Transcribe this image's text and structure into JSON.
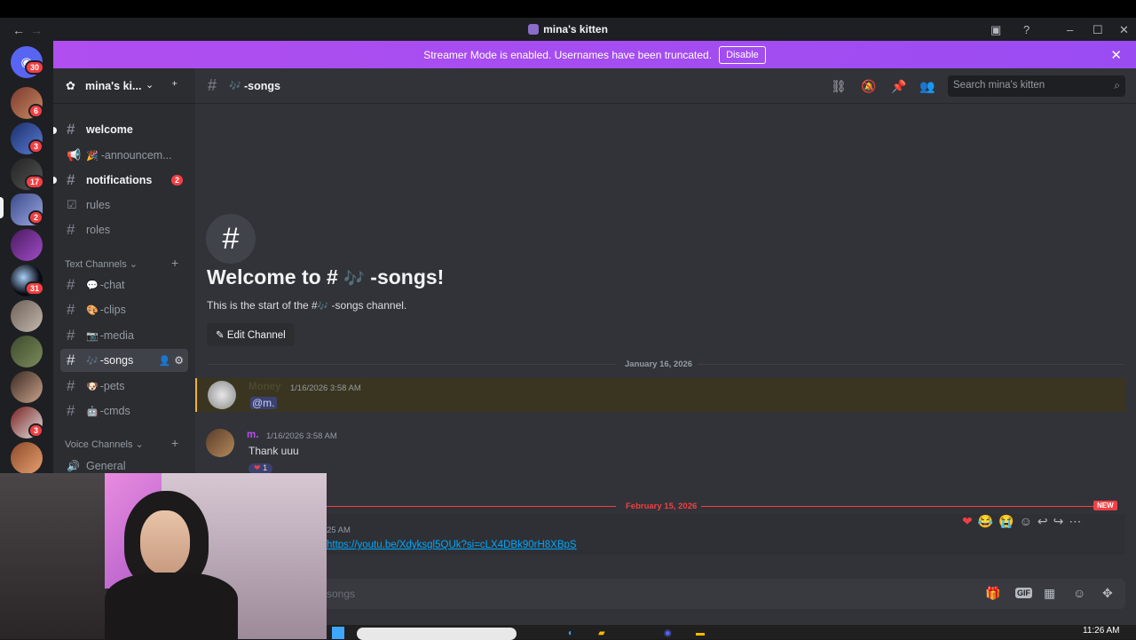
{
  "titlebar": {
    "title": "mina's kitten",
    "back": "←",
    "forward": "→",
    "minimize": "–",
    "maximize": "☐",
    "close": "✕"
  },
  "banner": {
    "text": "Streamer Mode is enabled. Usernames have been truncated.",
    "button": "Disable",
    "close": "✕"
  },
  "rail": {
    "home_badge": "30",
    "servers": [
      {
        "badge": "6"
      },
      {
        "badge": "3"
      },
      {
        "badge": "17"
      },
      {
        "badge": "2"
      },
      {
        "badge": ""
      },
      {
        "badge": "31"
      },
      {
        "badge": ""
      },
      {
        "badge": ""
      },
      {
        "badge": ""
      },
      {
        "badge": "3"
      },
      {
        "badge": ""
      }
    ]
  },
  "sidebar": {
    "guild_name": "mina's ki...",
    "channels_top": [
      {
        "name": "welcome",
        "style": "unread"
      },
      {
        "name": "-announcem...",
        "style": "muted"
      },
      {
        "name": "notifications",
        "style": "unread",
        "badge": "2"
      },
      {
        "name": "rules",
        "style": "normal"
      },
      {
        "name": "roles",
        "style": "normal"
      }
    ],
    "text_category": "Text Channels",
    "text_channels": [
      {
        "name": "-chat",
        "emoji": "💬"
      },
      {
        "name": "-clips",
        "emoji": "🎨"
      },
      {
        "name": "-media",
        "emoji": "📷"
      },
      {
        "name": "-songs",
        "emoji": "🎶"
      },
      {
        "name": "-pets",
        "emoji": "🐶"
      },
      {
        "name": "-cmds",
        "emoji": "🤖"
      }
    ],
    "voice_category": "Voice Channels",
    "voice_channels": [
      {
        "name": "General"
      }
    ]
  },
  "main": {
    "channel_name": "-songs",
    "search_placeholder": "Search mina's kitten",
    "welcome_hash": "#",
    "welcome_title_pre": "Welcome to #",
    "welcome_title_post": "-songs!",
    "welcome_sub_pre": "This is the start of the #",
    "welcome_sub_post": "-songs channel.",
    "edit_channel": "Edit Channel",
    "date_divider_1": "January 16, 2026",
    "date_divider_2": "February 15, 2026",
    "new_label": "NEW",
    "messages": [
      {
        "author": "Money",
        "time": "1/16/2026 3:58 AM",
        "content": "@m.",
        "highlight": true
      },
      {
        "author": "m.",
        "time": "1/16/2026 3:58 AM",
        "content": "Thank uuu",
        "reaction_count": "1"
      },
      {
        "time": "25 AM",
        "link": "https://youtu.be/Xdyksgl5QUk?si=cLX4DBk90rH8XBpS"
      }
    ],
    "composer_placeholder": "songs",
    "timestamp_clock": "11:26 AM"
  },
  "colors": {
    "accent": "#a855f7",
    "danger": "#f23f43",
    "link": "#00a8fc",
    "mention": "#5865f2"
  }
}
